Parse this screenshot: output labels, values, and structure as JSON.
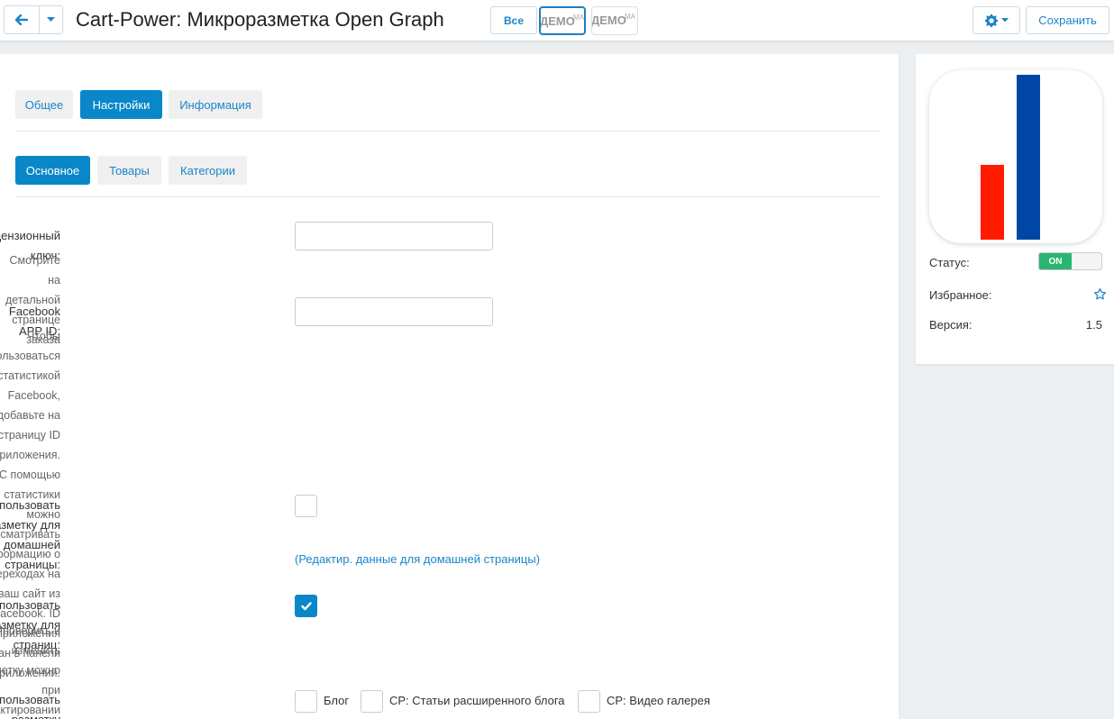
{
  "header": {
    "title": "Cart-Power: Микроразметка Open Graph",
    "all_label": "Все",
    "demo1_label": "ДЕМО",
    "demo1_sub": "MA",
    "demo2_label": "ДЕМО",
    "demo2_sub": "MA",
    "save_label": "Сохранить"
  },
  "tabs": [
    {
      "label": "Общее",
      "active": false
    },
    {
      "label": "Настройки",
      "active": true
    },
    {
      "label": "Информация",
      "active": false
    }
  ],
  "subtabs": [
    {
      "label": "Основное",
      "active": true
    },
    {
      "label": "Товары",
      "active": false
    },
    {
      "label": "Категории",
      "active": false
    }
  ],
  "form": {
    "license_label": "Лицензионный ключ:",
    "license_help": "Смотрите на детальной странице заказа",
    "license_value": "",
    "fb_label": "Facebook APP ID:",
    "fb_value": "",
    "fb_help": [
      "Чтобы воспользоваться статистикой",
      "Facebook, добавьте на страницу ID",
      "приложения.",
      "С помощью статистики можно просматривать",
      "информацию о переходах на ваш сайт из",
      "Facebook. ID приложения указан в панели",
      "приложений."
    ],
    "home_label_1": "Использовать разметку для домашней",
    "home_label_2": "страницы:",
    "home_checked": false,
    "home_link": "(Редактир. данные для домашней страницы)",
    "pages_label": "Использовать разметку для страниц:",
    "pages_checked": true,
    "pages_help_1": "Проверить и изменить разметку можно при",
    "pages_help_2": "редактировании страницы.",
    "use_for_label": "Использовать разметку для:",
    "use_for_options": [
      {
        "label": "Блог",
        "checked": false
      },
      {
        "label": "CP: Статьи расширенного блога",
        "checked": false
      },
      {
        "label": "CP: Видео галерея",
        "checked": false
      }
    ]
  },
  "sidebar": {
    "status_label": "Статус:",
    "status_value": "ON",
    "favorite_label": "Избранное:",
    "version_label": "Версия:",
    "version_value": "1.5"
  },
  "colors": {
    "accent": "#0a87c8",
    "link": "#1a85c9",
    "status_on": "#2ab573",
    "logo_red": "#ff1a00",
    "logo_blue": "#0047a5"
  },
  "icons": {
    "back": "arrow-left-icon",
    "dropdown": "caret-down-icon",
    "gear": "gear-icon",
    "favorite": "star-outline-icon",
    "check": "check-icon"
  }
}
